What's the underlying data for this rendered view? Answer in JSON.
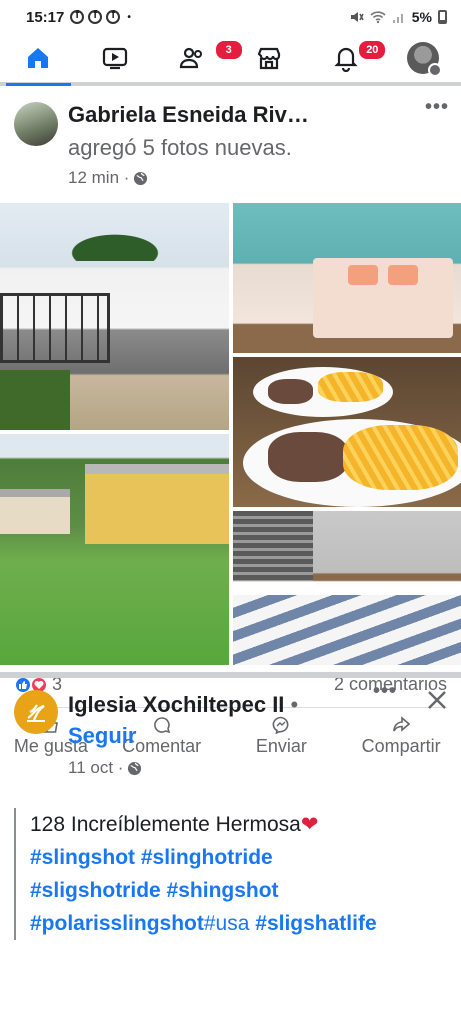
{
  "status_bar": {
    "time": "15:17",
    "dot": "•",
    "battery": "5%"
  },
  "nav": {
    "friends_badge": "3",
    "notifications_badge": "20"
  },
  "post1": {
    "author": "Gabriela Esneida Riv…",
    "action": "agregó 5 fotos nuevas.",
    "time": "12 min ·",
    "more": "•••",
    "reactions_count": "3",
    "comments": "2 comentarios",
    "actions": {
      "like": "Me gusta",
      "comment": "Comentar",
      "send": "Enviar",
      "share": "Compartir"
    }
  },
  "post2": {
    "author": "Iglesia Xochiltepec II",
    "separator": "•",
    "follow": "Seguir",
    "time": "11 oct ·",
    "more": "•••",
    "text_line": "128 Increíblemente Hermosa",
    "hashtags_line1": [
      "#slingshot",
      "#slinghotride"
    ],
    "hashtags_line2": [
      "#sligshotride",
      "#shingshot"
    ],
    "hashtags_line3": {
      "tag1": "#polarisslingshot",
      "plain": "#usa",
      "tag2": "#sligshatlife"
    }
  },
  "colors": {
    "accent": "#1877f2",
    "badge": "#e41e3f",
    "love": "#f33e58"
  }
}
